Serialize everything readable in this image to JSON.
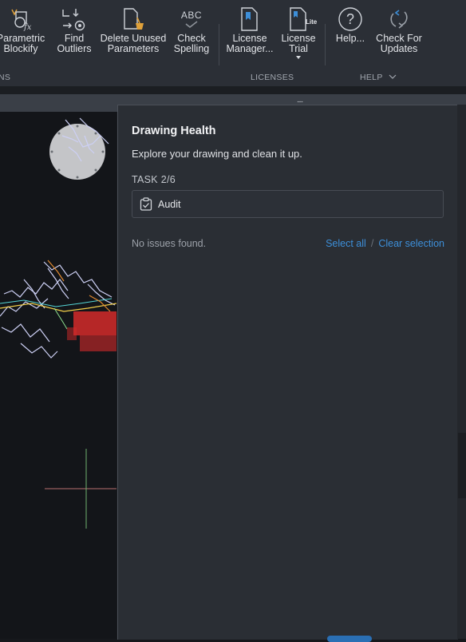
{
  "ribbon": {
    "buttons": [
      {
        "id": "parametric-blockify",
        "label": "Parametric\nBlockify",
        "icon": "parametric-blockify-icon"
      },
      {
        "id": "find-outliers",
        "label": "Find\nOutliers",
        "icon": "find-outliers-icon"
      },
      {
        "id": "delete-unused-parameters",
        "label": "Delete Unused\nParameters",
        "icon": "delete-unused-icon"
      },
      {
        "id": "check-spelling",
        "label": "Check\nSpelling",
        "icon": "check-spelling-icon"
      },
      {
        "id": "license-manager",
        "label": "License\nManager...",
        "icon": "license-manager-icon"
      },
      {
        "id": "license-trial",
        "label": "License\nTrial",
        "icon": "license-trial-icon"
      },
      {
        "id": "help",
        "label": "Help...",
        "icon": "help-icon"
      },
      {
        "id": "check-updates",
        "label": "Check For\nUpdates",
        "icon": "refresh-icon"
      }
    ],
    "icon_text": {
      "abc": "ABC",
      "lite": "Lite",
      "question": "?"
    },
    "groups": {
      "left": "NS",
      "licenses": "LICENSES",
      "help": "HELP"
    }
  },
  "grip": "....",
  "panel": {
    "title": "Drawing Health",
    "description": "Explore your drawing and clean it up.",
    "task_label": "TASK 2/6",
    "task_name": "Audit",
    "status": "No issues found.",
    "select_all": "Select all",
    "divider": "/",
    "clear_selection": "Clear selection"
  },
  "colors": {
    "accent_link": "#3d8fd9",
    "ribbon_bg": "#2b2f36",
    "panel_bg": "#2a2e34",
    "canvas_bg": "#131519"
  }
}
